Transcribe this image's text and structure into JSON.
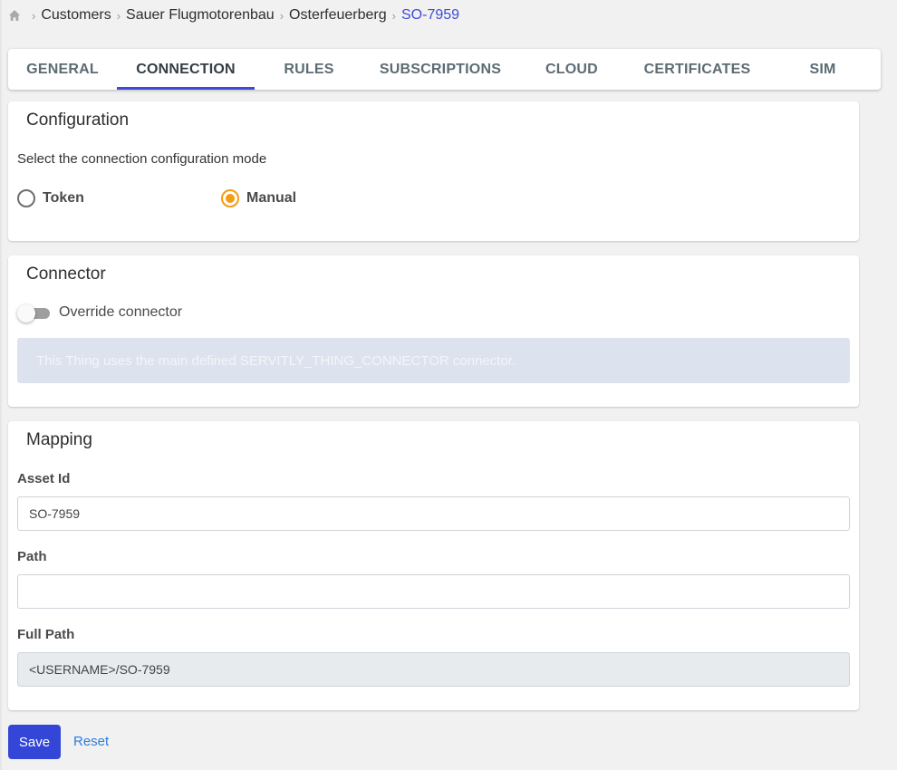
{
  "breadcrumb": {
    "home_icon": "home-icon",
    "separator_icon": "chevron-right-icon",
    "items": [
      "Customers",
      "Sauer Flugmotorenbau",
      "Osterfeuerberg",
      "SO-7959"
    ],
    "current_color": "#3d4bd6"
  },
  "tabs": {
    "items": [
      {
        "label": "GENERAL"
      },
      {
        "label": "CONNECTION",
        "active": true
      },
      {
        "label": "RULES"
      },
      {
        "label": "SUBSCRIPTIONS"
      },
      {
        "label": "CLOUD"
      },
      {
        "label": "CERTIFICATES"
      },
      {
        "label": "SIM"
      }
    ],
    "active_indicator_color": "#3d4bd6"
  },
  "configuration": {
    "title": "Configuration",
    "description": "Select the connection configuration mode",
    "options": [
      {
        "label": "Token",
        "checked": false
      },
      {
        "label": "Manual",
        "checked": true
      }
    ],
    "accent_color": "#f59c12"
  },
  "connector": {
    "title": "Connector",
    "override_label": "Override connector",
    "override_enabled": false,
    "info_text": "This Thing uses the main defined SERVITLY_THING_CONNECTOR connector."
  },
  "mapping": {
    "title": "Mapping",
    "asset_id": {
      "label": "Asset Id",
      "value": "SO-7959"
    },
    "path": {
      "label": "Path",
      "value": ""
    },
    "full_path": {
      "label": "Full Path",
      "value": "<USERNAME>/SO-7959"
    }
  },
  "actions": {
    "save_label": "Save",
    "reset_label": "Reset",
    "save_color": "#3346d8",
    "reset_color": "#2b7de0"
  }
}
